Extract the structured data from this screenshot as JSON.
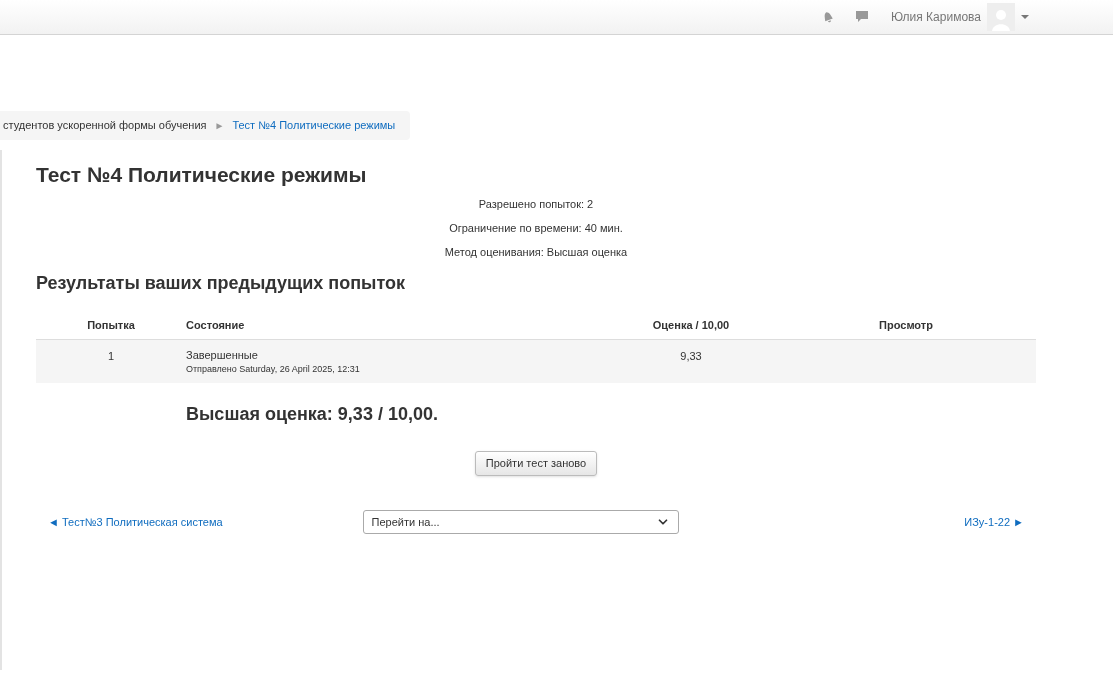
{
  "navbar": {
    "user_name": "Юлия Каримова"
  },
  "breadcrumb": {
    "items": [
      "студентов ускоренной формы обучения",
      "Тест №4 Политические режимы"
    ],
    "separator": "►"
  },
  "title": "Тест №4 Политические режимы",
  "quiz_info": [
    "Разрешено попыток: 2",
    "Ограничение по времени: 40 мин.",
    "Метод оценивания: Высшая оценка"
  ],
  "attempts": {
    "heading": "Результаты ваших предыдущих попыток",
    "columns": [
      "Попытка",
      "Состояние",
      "Оценка / 10,00",
      "Просмотр"
    ],
    "rows": [
      {
        "attempt": "1",
        "state": "Завершенные",
        "submitted": "Отправлено Saturday, 26 April 2025, 12:31",
        "grade": "9,33"
      }
    ]
  },
  "highest_grade": "Высшая оценка: 9,33 / 10,00.",
  "retake_button": "Пройти тест заново",
  "navigation": {
    "prev": "◄ Тест№3 Политическая система",
    "jump_select": {
      "value": "Перейти на..."
    },
    "next": "ИЗу-1-22 ►"
  }
}
